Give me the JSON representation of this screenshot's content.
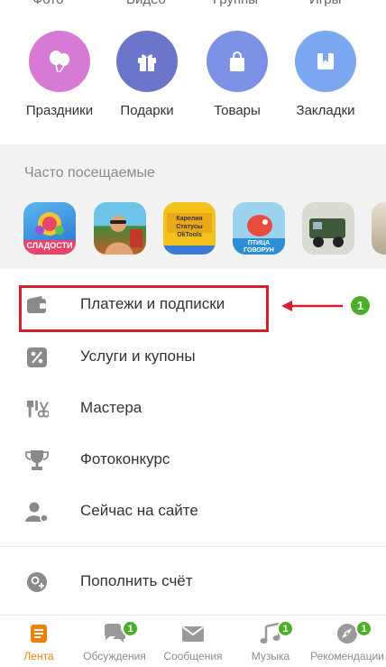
{
  "top_tabs": [
    "Фото",
    "Видео",
    "Группы",
    "Игры"
  ],
  "shortcuts": [
    {
      "label": "Праздники",
      "icon": "balloons-icon",
      "color": "#d77ad5"
    },
    {
      "label": "Подарки",
      "icon": "gift-icon",
      "color": "#6b75c9"
    },
    {
      "label": "Товары",
      "icon": "shopping-bag-icon",
      "color": "#7d91e6"
    },
    {
      "label": "Закладки",
      "icon": "bookmark-icon",
      "color": "#7aa7ef"
    }
  ],
  "frequent": {
    "title": "Часто посещаемые",
    "apps": [
      {
        "name": "СЛАДОСТИ"
      },
      {
        "name": "profile-photo"
      },
      {
        "name": "Карелия Статусы OkTools"
      },
      {
        "name": "ПТИЦА ГОВОРУН"
      },
      {
        "name": "military-truck"
      },
      {
        "name": "partial-app"
      }
    ]
  },
  "menu": [
    {
      "label": "Платежи и подписки",
      "icon": "wallet-icon"
    },
    {
      "label": "Услуги и купоны",
      "icon": "percent-icon"
    },
    {
      "label": "Мастера",
      "icon": "tools-icon"
    },
    {
      "label": "Фотоконкурс",
      "icon": "trophy-icon"
    },
    {
      "label": "Сейчас на сайте",
      "icon": "user-online-icon"
    },
    {
      "label": "Пополнить счёт",
      "icon": "add-money-icon"
    }
  ],
  "annotation": {
    "number": "1",
    "highlight_color": "#d4202a"
  },
  "tabbar": [
    {
      "label": "Лента",
      "icon": "feed-icon",
      "active": true,
      "badge": ""
    },
    {
      "label": "Обсуждения",
      "icon": "discussions-icon",
      "active": false,
      "badge": "1"
    },
    {
      "label": "Сообщения",
      "icon": "messages-icon",
      "active": false,
      "badge": ""
    },
    {
      "label": "Музыка",
      "icon": "music-icon",
      "active": false,
      "badge": "1"
    },
    {
      "label": "Рекомендации",
      "icon": "recommendations-icon",
      "active": false,
      "badge": "1"
    }
  ],
  "colors": {
    "accent": "#ee8208",
    "badge": "#4caf2a",
    "icon_gray": "#8a8a8a"
  }
}
